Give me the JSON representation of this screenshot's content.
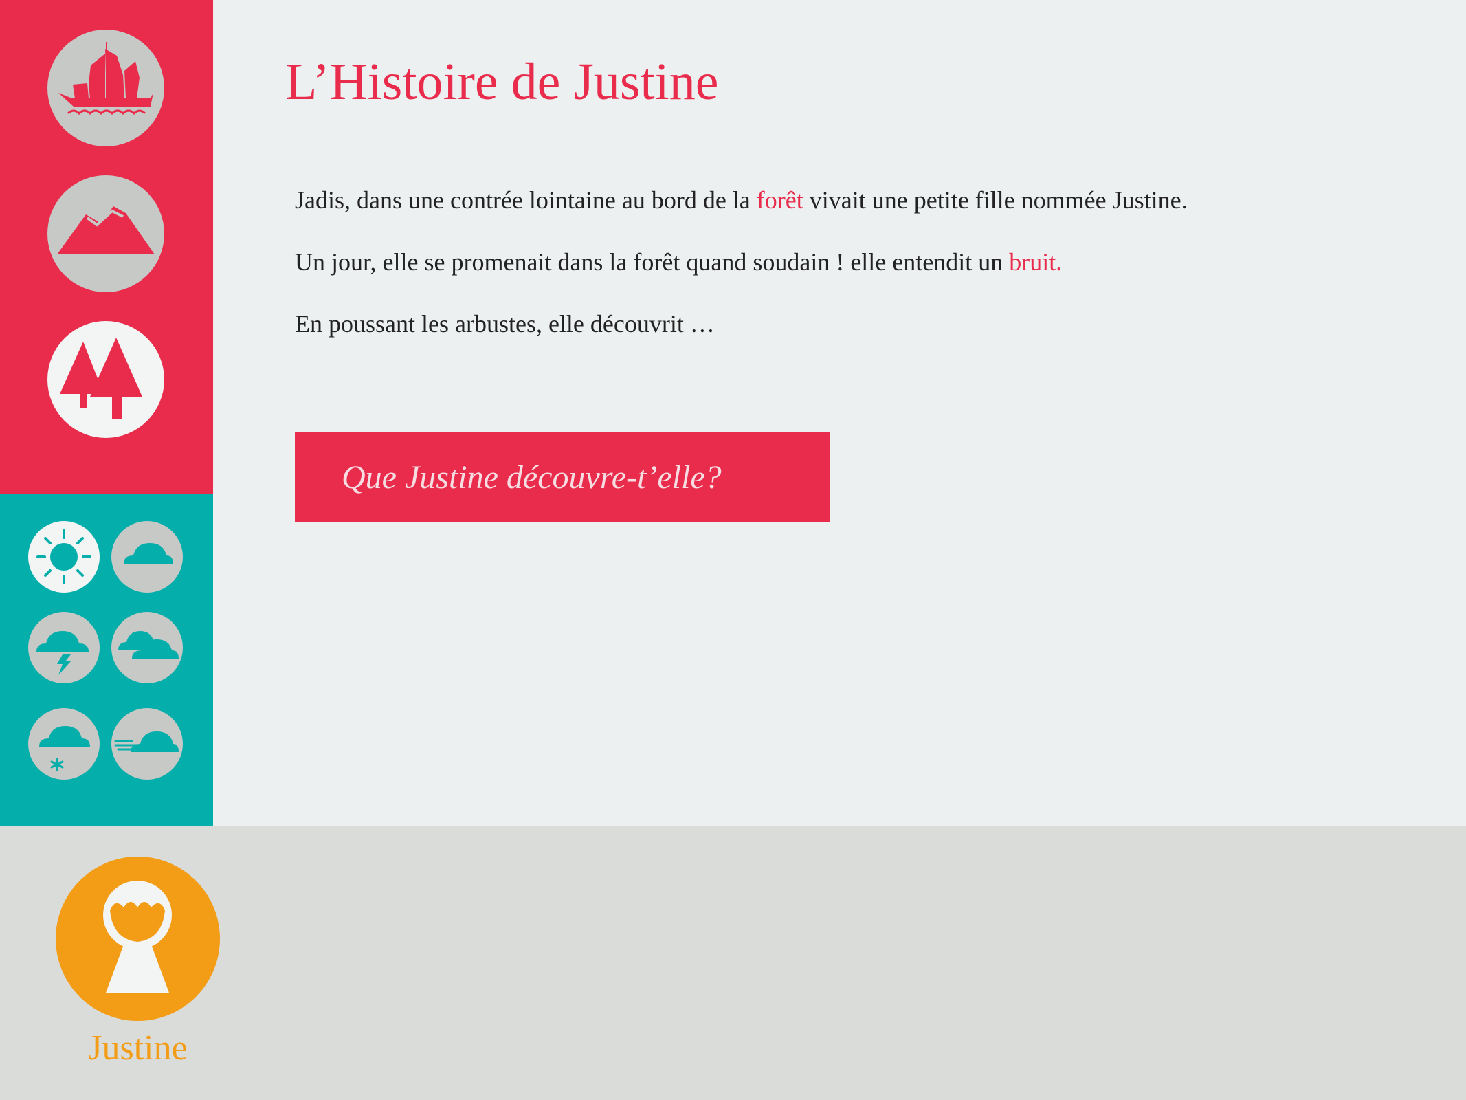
{
  "colors": {
    "accent_red": "#e92c4c",
    "teal": "#04aeaa",
    "icon_gray": "#c6c9c6",
    "icon_light": "#f3f4f4",
    "orange": "#f39c16",
    "background": "#edf0f1",
    "bottom_bar": "#dadcda"
  },
  "sidebar": {
    "places": [
      {
        "icon": "junk-boat-icon"
      },
      {
        "icon": "mountain-icon"
      },
      {
        "icon": "forest-icon",
        "selected": true
      }
    ],
    "weather": [
      {
        "icon": "sun-icon",
        "selected": true
      },
      {
        "icon": "cloud-icon"
      },
      {
        "icon": "storm-icon"
      },
      {
        "icon": "clouds-icon"
      },
      {
        "icon": "snow-icon"
      },
      {
        "icon": "wind-icon"
      }
    ]
  },
  "main": {
    "title": "L’Histoire de Justine",
    "paragraph1": {
      "before": "Jadis, dans une contrée lointaine au bord de la ",
      "highlight": "forêt",
      "after": " vivait une petite fille nommée Justine."
    },
    "paragraph2": {
      "before": "Un jour, elle se promenait dans la forêt quand soudain ! elle entendit un ",
      "highlight": "bruit."
    },
    "paragraph3": "En poussant les arbustes, elle découvrit …",
    "cta_label": "Que Justine découvre-t’elle?"
  },
  "character": {
    "name": "Justine",
    "icon": "girl-avatar-icon"
  }
}
